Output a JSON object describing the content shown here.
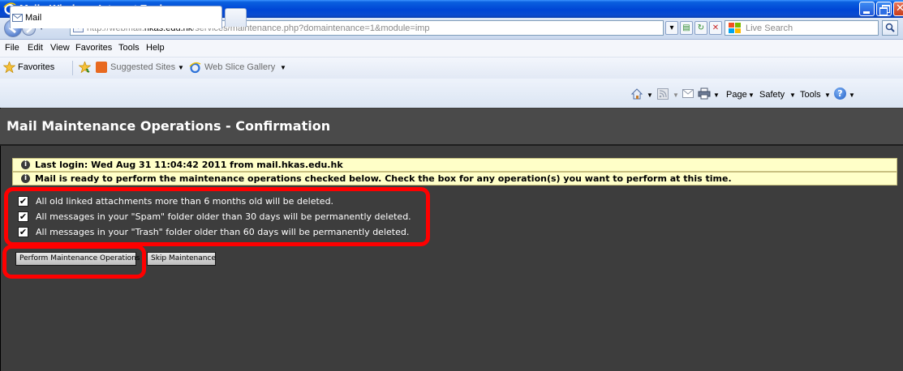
{
  "window": {
    "title": "Mail - Windows Internet Explorer"
  },
  "address_bar": {
    "url_prefix": "http://webmail.",
    "url_host": "hkas.edu.hk",
    "url_rest": "/services/maintenance.php?domaintenance=1&module=imp",
    "search_placeholder": "Live Search"
  },
  "menu": {
    "items": [
      "File",
      "Edit",
      "View",
      "Favorites",
      "Tools",
      "Help"
    ]
  },
  "favorites_bar": {
    "favorites_label": "Favorites",
    "suggested_sites": "Suggested Sites",
    "web_slice_gallery": "Web Slice Gallery"
  },
  "tabs": {
    "active_tab": "Mail"
  },
  "command_bar": {
    "page": "Page",
    "safety": "Safety",
    "tools": "Tools"
  },
  "content": {
    "title": "Mail Maintenance Operations - Confirmation",
    "notices": [
      "Last login: Wed Aug 31 11:04:42 2011 from mail.hkas.edu.hk",
      "Mail is ready to perform the maintenance operations checked below. Check the box for any operation(s) you want to perform at this time."
    ],
    "operations": [
      {
        "label": "All old linked attachments more than 6 months old will be deleted.",
        "checked": true
      },
      {
        "label": "All messages in your \"Spam\" folder older than 30 days will be permanently deleted.",
        "checked": true
      },
      {
        "label": "All messages in your \"Trash\" folder older than 60 days will be permanently deleted.",
        "checked": true
      }
    ],
    "perform_button": "Perform Maintenance Operations",
    "skip_button": "Skip Maintenance"
  },
  "colors": {
    "title_bar": "#0046d5",
    "page_background": "#3d3d3d",
    "notice_background": "#ffffc8",
    "highlight": "#ff0000"
  }
}
